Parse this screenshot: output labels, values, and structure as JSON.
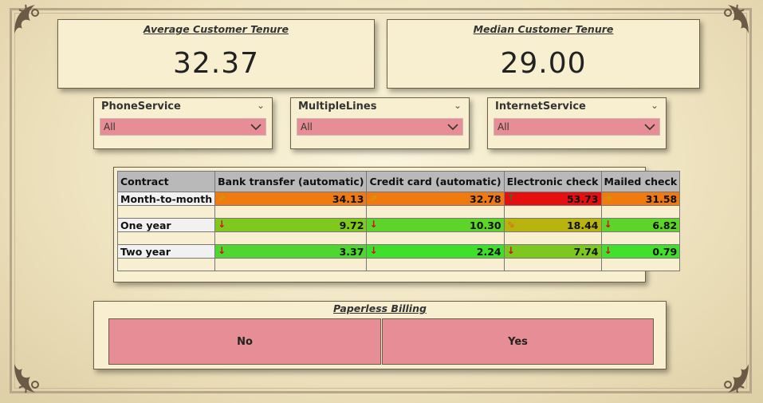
{
  "kpis": {
    "avg_tenure": {
      "title": "Average Customer Tenure",
      "value": "32.37"
    },
    "median_tenure": {
      "title": "Median Customer Tenure",
      "value": "29.00"
    }
  },
  "slicers": [
    {
      "label": "PhoneService",
      "selected": "All"
    },
    {
      "label": "MultipleLines",
      "selected": "All"
    },
    {
      "label": "InternetService",
      "selected": "All"
    }
  ],
  "matrix": {
    "corner_header": "Contract",
    "columns": [
      "Bank transfer (automatic)",
      "Credit card (automatic)",
      "Electronic check",
      "Mailed check"
    ],
    "rows": [
      {
        "label": "Month-to-month",
        "values": [
          "34.13",
          "32.78",
          "53.73",
          "31.58"
        ]
      },
      {
        "label": "One year",
        "values": [
          "9.72",
          "10.30",
          "18.44",
          "6.82"
        ]
      },
      {
        "label": "Two year",
        "values": [
          "3.37",
          "2.24",
          "7.74",
          "0.79"
        ]
      }
    ],
    "cell_colors": [
      [
        "#ef7a10",
        "#ef7a10",
        "#e60f0f",
        "#ef7a10"
      ],
      [
        "#7fc91f",
        "#5cd42a",
        "#b8b40f",
        "#5cd42a"
      ],
      [
        "#4fd630",
        "#3fe02c",
        "#7cc81f",
        "#43df2d"
      ]
    ],
    "cell_icons": [
      [
        "arrow-up-right-icon",
        "arrow-up-right-icon",
        "arrow-up-icon",
        "arrow-right-icon"
      ],
      [
        "arrow-down-icon",
        "arrow-down-icon",
        "arrow-down-right-icon",
        "arrow-down-icon"
      ],
      [
        "arrow-down-icon",
        "arrow-down-icon",
        "arrow-down-icon",
        "arrow-down-icon"
      ]
    ]
  },
  "paperless": {
    "title": "Paperless Billing",
    "options": [
      "No",
      "Yes"
    ]
  }
}
